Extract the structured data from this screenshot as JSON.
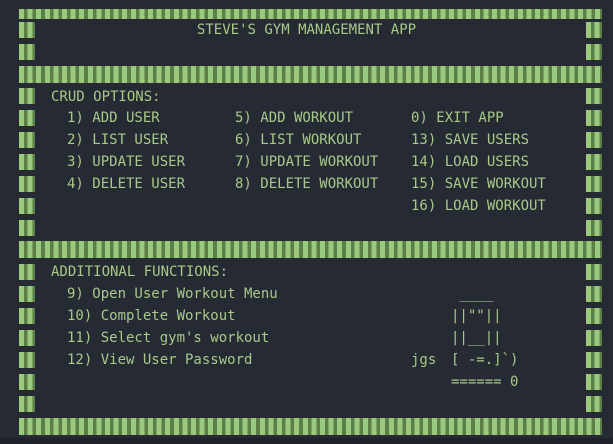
{
  "header": {
    "title": "STEVE'S GYM MANAGEMENT APP"
  },
  "crud": {
    "heading": "CRUD OPTIONS:",
    "col1": [
      "1) ADD USER",
      "2) LIST USER",
      "3) UPDATE USER",
      "4) DELETE USER"
    ],
    "col2": [
      "5) ADD WORKOUT",
      "6) LIST WORKOUT",
      "7) UPDATE WORKOUT",
      "8) DELETE WORKOUT"
    ],
    "col3": [
      "0) EXIT APP",
      "13) SAVE USERS",
      "14) LOAD USERS",
      "15) SAVE WORKOUT",
      "16) LOAD WORKOUT"
    ]
  },
  "additional": {
    "heading": "ADDITIONAL FUNCTIONS:",
    "items": [
      "9) Open User Workout Menu",
      "10) Complete Workout",
      "11) Select gym's workout",
      "12) View User Password"
    ]
  },
  "ascii_art": {
    "lines": [
      " ____",
      "||\"\"||",
      "||__||",
      "[ -=.]`)",
      "====== 0"
    ],
    "signature": "jgs"
  },
  "colors": {
    "background": "#262a33",
    "text": "#a7c98a",
    "border_light": "#9bc97d",
    "border_dark": "#5c7f47"
  }
}
